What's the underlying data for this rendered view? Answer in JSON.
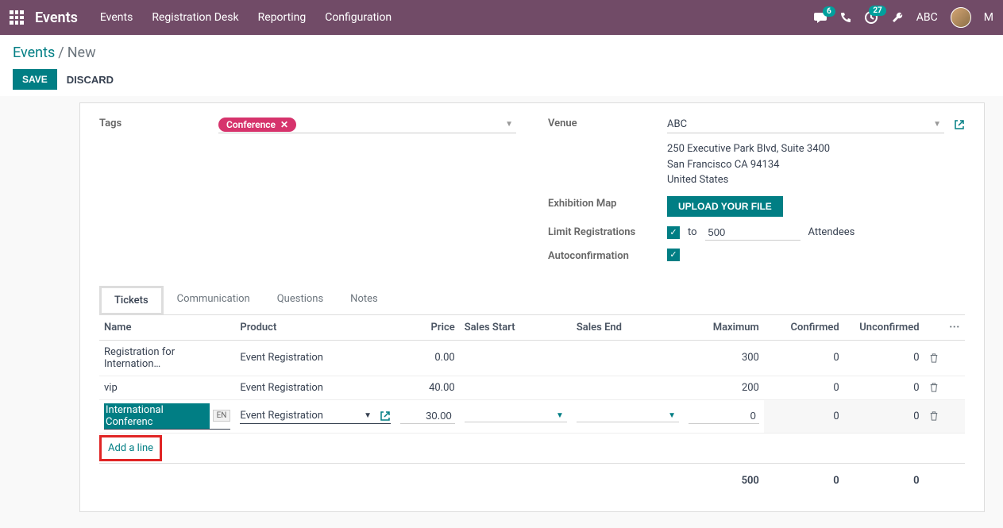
{
  "topbar": {
    "brand": "Events",
    "menu": [
      "Events",
      "Registration Desk",
      "Reporting",
      "Configuration"
    ],
    "msg_count": "6",
    "activity_count": "27",
    "user": "ABC",
    "user_suffix": "M"
  },
  "breadcrumb": {
    "root": "Events",
    "current": "New"
  },
  "actions": {
    "save": "SAVE",
    "discard": "DISCARD"
  },
  "form": {
    "left": {
      "tags_label": "Tags",
      "tag_value": "Conference"
    },
    "right": {
      "venue_label": "Venue",
      "venue_name": "ABC",
      "addr1": "250 Executive Park Blvd, Suite 3400",
      "addr2": "San Francisco CA 94134",
      "addr3": "United States",
      "map_label": "Exhibition Map",
      "upload": "UPLOAD YOUR FILE",
      "limit_label": "Limit Registrations",
      "limit_to": "to",
      "limit_val": "500",
      "limit_suffix": "Attendees",
      "auto_label": "Autoconfirmation"
    }
  },
  "tabs": [
    "Tickets",
    "Communication",
    "Questions",
    "Notes"
  ],
  "table": {
    "headers": [
      "Name",
      "Product",
      "Price",
      "Sales Start",
      "Sales End",
      "Maximum",
      "Confirmed",
      "Unconfirmed"
    ],
    "rows": [
      {
        "name": "Registration for Internation…",
        "product": "Event Registration",
        "price": "0.00",
        "start": "",
        "end": "",
        "max": "300",
        "conf": "0",
        "unconf": "0"
      },
      {
        "name": "vip",
        "product": "Event Registration",
        "price": "40.00",
        "start": "",
        "end": "",
        "max": "200",
        "conf": "0",
        "unconf": "0"
      }
    ],
    "editing": {
      "name": "International Conferenc",
      "lang": "EN",
      "product": "Event Registration",
      "price": "30.00",
      "max": "0",
      "conf": "0",
      "unconf": "0"
    },
    "add_line": "Add a line",
    "totals": {
      "max": "500",
      "conf": "0",
      "unconf": "0"
    }
  }
}
